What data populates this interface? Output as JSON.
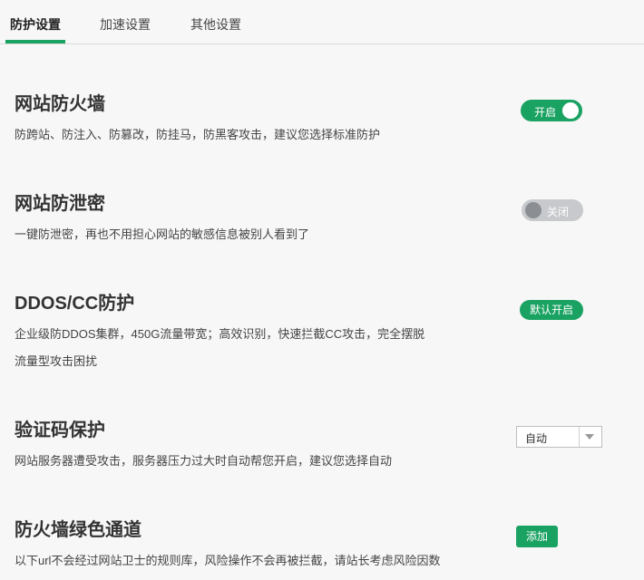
{
  "tabs": [
    {
      "label": "防护设置",
      "active": true
    },
    {
      "label": "加速设置",
      "active": false
    },
    {
      "label": "其他设置",
      "active": false
    }
  ],
  "colors": {
    "accent": "#1aa262",
    "switch_off_bg": "#c7c9cc",
    "switch_off_knob": "#8b8f93"
  },
  "sections": {
    "firewall": {
      "title": "网站防火墙",
      "desc": "防跨站、防注入、防篡改，防挂马，防黑客攻击，建议您选择标准防护",
      "toggle_label": "开启",
      "toggle_state": "on"
    },
    "leak": {
      "title": "网站防泄密",
      "desc": "一键防泄密，再也不用担心网站的敏感信息被别人看到了",
      "toggle_label": "关闭",
      "toggle_state": "off"
    },
    "ddos": {
      "title": "DDOS/CC防护",
      "desc_line1": "企业级防DDOS集群，450G流量带宽；高效识别，快速拦截CC攻击，完全摆脱",
      "desc_line2": "流量型攻击困扰",
      "badge": "默认开启"
    },
    "captcha": {
      "title": "验证码保护",
      "desc": "网站服务器遭受攻击，服务器压力过大时自动帮您开启，建议您选择自动",
      "select_value": "自动"
    },
    "greenlane": {
      "title": "防火墙绿色通道",
      "desc": "以下url不会经过网站卫士的规则库，风险操作不会再被拦截，请站长考虑风险因数",
      "button": "添加"
    }
  }
}
